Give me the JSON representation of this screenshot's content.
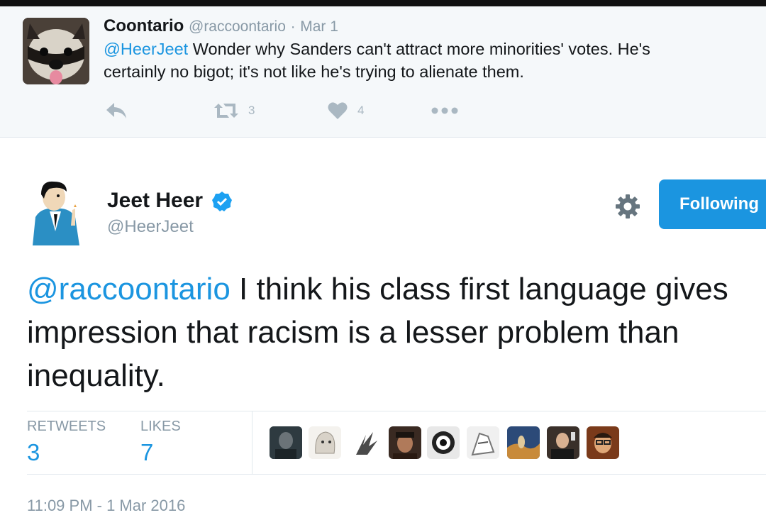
{
  "parent_tweet": {
    "name": "Coontario",
    "handle": "@raccoontario",
    "date": "Mar 1",
    "text_mention": "@HeerJeet",
    "text_line1": " Wonder why Sanders can't attract more minorities' votes. He's",
    "text_line2": "certainly no bigot; it's not like he's trying to alienate them.",
    "retweets": "3",
    "likes": "4"
  },
  "main_tweet": {
    "name": "Jeet Heer",
    "handle": "@HeerJeet",
    "follow_label": "Following",
    "text_mention": "@raccoontario",
    "text_body": " I think his class first language gives impression that racism is a lesser problem than inequality.",
    "retweets_label": "RETWEETS",
    "retweets_value": "3",
    "likes_label": "LIKES",
    "likes_value": "7",
    "timestamp": "11:09 PM - 1 Mar 2016"
  },
  "icons": {
    "reply": "reply-icon",
    "retweet": "retweet-icon",
    "like": "heart-icon",
    "more": "more-icon",
    "settings": "gear-icon",
    "verified": "verified-badge-icon"
  },
  "colors": {
    "accent": "#1b95e0",
    "muted": "#8899a6",
    "parent_bg": "#f5f8fa"
  }
}
